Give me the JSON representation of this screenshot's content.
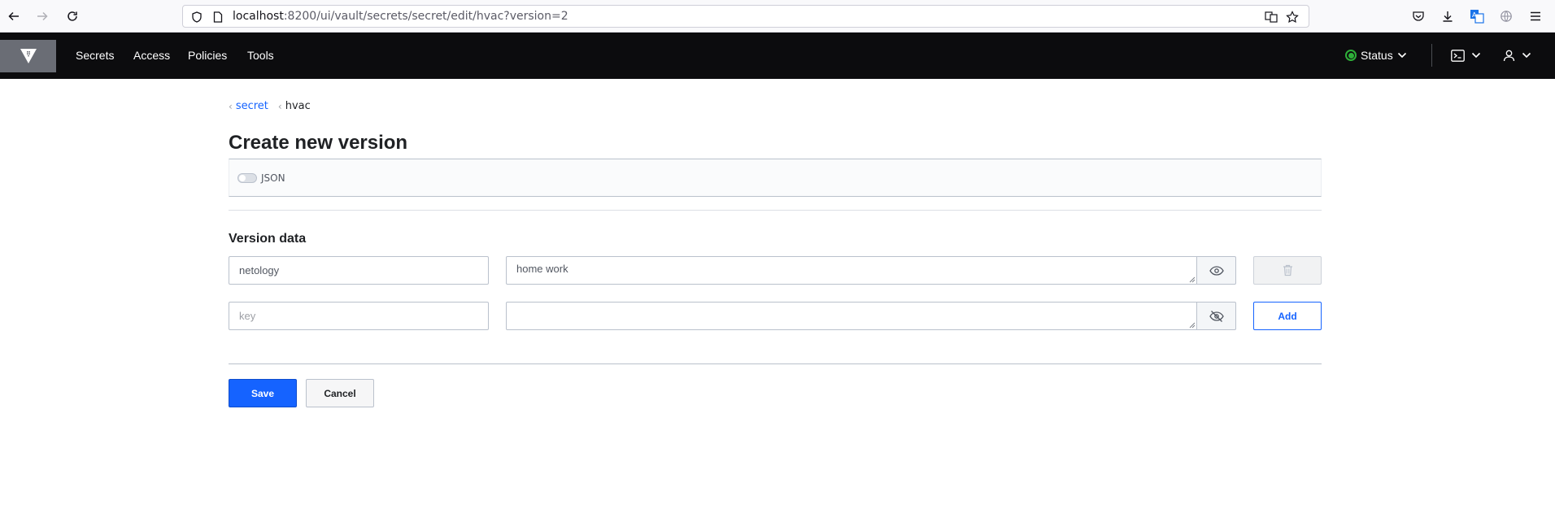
{
  "browser": {
    "url_host": "localhost",
    "url_rest": ":8200/ui/vault/secrets/secret/edit/hvac?version=2"
  },
  "nav": {
    "links": [
      "Secrets",
      "Access",
      "Policies",
      "Tools"
    ],
    "status_label": "Status",
    "status_color": "#2eb039"
  },
  "breadcrumb": {
    "items": [
      "secret",
      "hvac"
    ]
  },
  "page": {
    "title": "Create new version",
    "json_toggle_label": "JSON",
    "json_toggle_on": false,
    "section_title": "Version data"
  },
  "rows": [
    {
      "key": "netology",
      "value": "home work",
      "masked": false,
      "action": "delete"
    },
    {
      "key": "",
      "key_placeholder": "key",
      "value": "",
      "masked": true,
      "action": "Add"
    }
  ],
  "buttons": {
    "save": "Save",
    "cancel": "Cancel",
    "add": "Add"
  },
  "colors": {
    "accent": "#1563ff",
    "nav_bg": "#0c0c0e"
  }
}
